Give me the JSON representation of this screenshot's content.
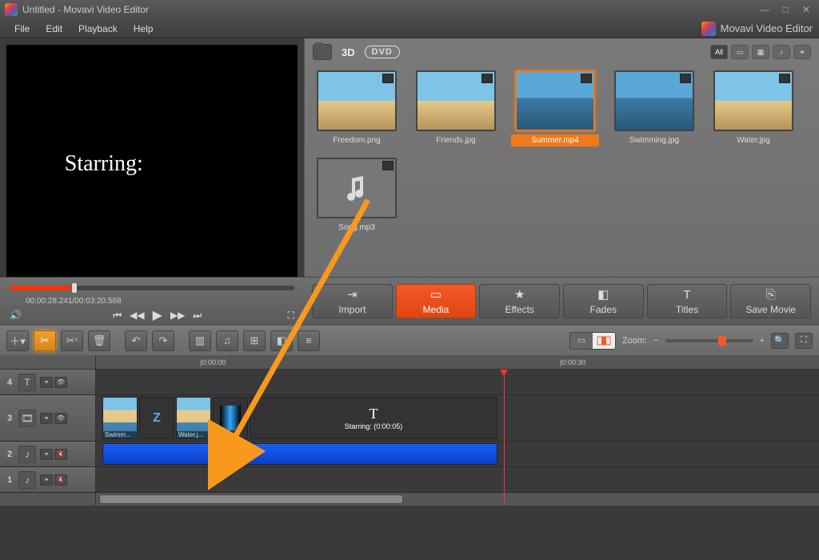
{
  "window": {
    "title": "Untitled - Movavi Video Editor"
  },
  "menu": {
    "file": "File",
    "edit": "Edit",
    "playback": "Playback",
    "help": "Help",
    "brand": "Movavi Video Editor"
  },
  "preview": {
    "overlay_text": "Starring:"
  },
  "media_toolbar": {
    "threeD": "3D",
    "dvd": "DVD",
    "all": "All"
  },
  "media": {
    "items": [
      {
        "name": "Freedom.png"
      },
      {
        "name": "Friends.jpg"
      },
      {
        "name": "Summer.mp4"
      },
      {
        "name": "Swimming.jpg"
      },
      {
        "name": "Water.jpg"
      },
      {
        "name": "Song.mp3"
      }
    ]
  },
  "playback": {
    "current": "00:00:28.241",
    "total": "00:03:20.568",
    "separator": " / "
  },
  "tabs": {
    "import": "Import",
    "media": "Media",
    "effects": "Effects",
    "fades": "Fades",
    "titles": "Titles",
    "save": "Save Movie"
  },
  "zoom": {
    "label": "Zoom:"
  },
  "ruler": {
    "t0": "|0:00:00",
    "t30": "|0:00:30"
  },
  "tracks": {
    "t4": "4",
    "t3": "3",
    "t2": "2",
    "t1": "1",
    "clip_swim": "Swimm...",
    "clip_water": "Water.j...",
    "text_T": "T",
    "text_sub": "Starring: (0:00:05)",
    "trans_Z": "Z"
  }
}
